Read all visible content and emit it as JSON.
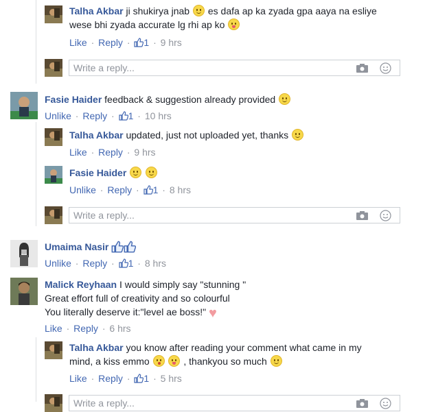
{
  "comments": [
    {
      "author": "Talha Akbar",
      "text_1": " ji shukirya jnab ",
      "text_2": " es dafa ap ka zyada gpa aaya na esliye",
      "text_3": "wese bhi zyada accurate lg rhi ap ko ",
      "like": "Like",
      "reply": "Reply",
      "likes": "1",
      "time": "9 hrs"
    },
    {
      "author": "Fasie Haider",
      "text": " feedback & suggestion already provided ",
      "like": "Unlike",
      "reply": "Reply",
      "likes": "1",
      "time": "10 hrs"
    },
    {
      "author": "Talha Akbar",
      "text": " updated, just not uploaded yet, thanks ",
      "like": "Like",
      "reply": "Reply",
      "time": "9 hrs"
    },
    {
      "author": "Fasie Haider",
      "like": "Unlike",
      "reply": "Reply",
      "likes": "1",
      "time": "8 hrs"
    },
    {
      "author": "Umaima Nasir",
      "like": "Unlike",
      "reply": "Reply",
      "likes": "1",
      "time": "8 hrs"
    },
    {
      "author": "Malick Reyhaan",
      "text_1": " I would simply say \"stunning \"",
      "text_2": "Great effort full of creativity and so colourful",
      "text_3": "You literally deserve it:\"level ae boss!\" ",
      "like": "Like",
      "reply": "Reply",
      "time": "6 hrs"
    },
    {
      "author": "Talha Akbar",
      "text_1": " you know after reading your comment what came in my",
      "text_2": "mind, a kiss emmo ",
      "text_3": " , thankyou so much ",
      "like": "Like",
      "reply": "Reply",
      "likes": "1",
      "time": "5 hrs"
    }
  ],
  "reply_placeholder": "Write a reply...",
  "colors": {
    "link": "#365899",
    "action": "#4267b2",
    "muted": "#90949c"
  },
  "icons": [
    "smiley-emoji",
    "tongue-emoji",
    "kiss-emoji",
    "heart-emoji",
    "thumbs-up-icon",
    "camera-icon",
    "smiley-icon"
  ]
}
